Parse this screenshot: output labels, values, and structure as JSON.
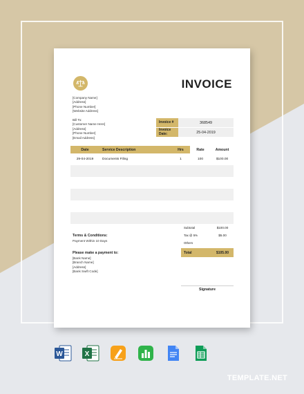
{
  "colors": {
    "accent": "#d3b76a",
    "tan_bg": "#d6c7a6",
    "grey_bg": "#e6e8ec"
  },
  "invoice": {
    "title": "INVOICE",
    "company_lines": [
      "[Company Name]",
      "[Address]",
      "[Phone Number]",
      "[Website Address]"
    ],
    "bill_to_lines": [
      "Bill To:",
      "[Customer Name Here]",
      "[Address]",
      "[Phone Number]",
      "[Email Address]"
    ],
    "meta": [
      {
        "label": "Invoice #",
        "value": "368549"
      },
      {
        "label": "Invoice Date:",
        "value": "25-04-2019"
      }
    ],
    "table": {
      "headers": [
        "Date",
        "Service Description",
        "Hrs",
        "Rate",
        "Amount"
      ],
      "rows": [
        [
          "29-04-2019",
          "Documents Filing",
          "1",
          "100",
          "$100.00"
        ]
      ]
    },
    "totals": [
      {
        "label": "Subtotal",
        "value": "$100.00"
      },
      {
        "label": "Tax @ 5%",
        "value": "$5.00"
      },
      {
        "label": "Others",
        "value": ""
      }
    ],
    "total": {
      "label": "Total",
      "value": "$105.00"
    },
    "terms_heading": "Terms & Conditions:",
    "terms_text": "Payment Within 10 Days",
    "payment_heading": "Please make a payment to:",
    "payment_lines": [
      "[Bank Name]",
      "[Branch Name]",
      "[Address]",
      "[Bank Swift Code]"
    ],
    "signature_label": "Signature"
  },
  "apps": [
    "word-icon",
    "excel-icon",
    "pages-icon",
    "numbers-icon",
    "google-docs-icon",
    "google-sheets-icon"
  ],
  "brand": "TEMPLATE.NET"
}
